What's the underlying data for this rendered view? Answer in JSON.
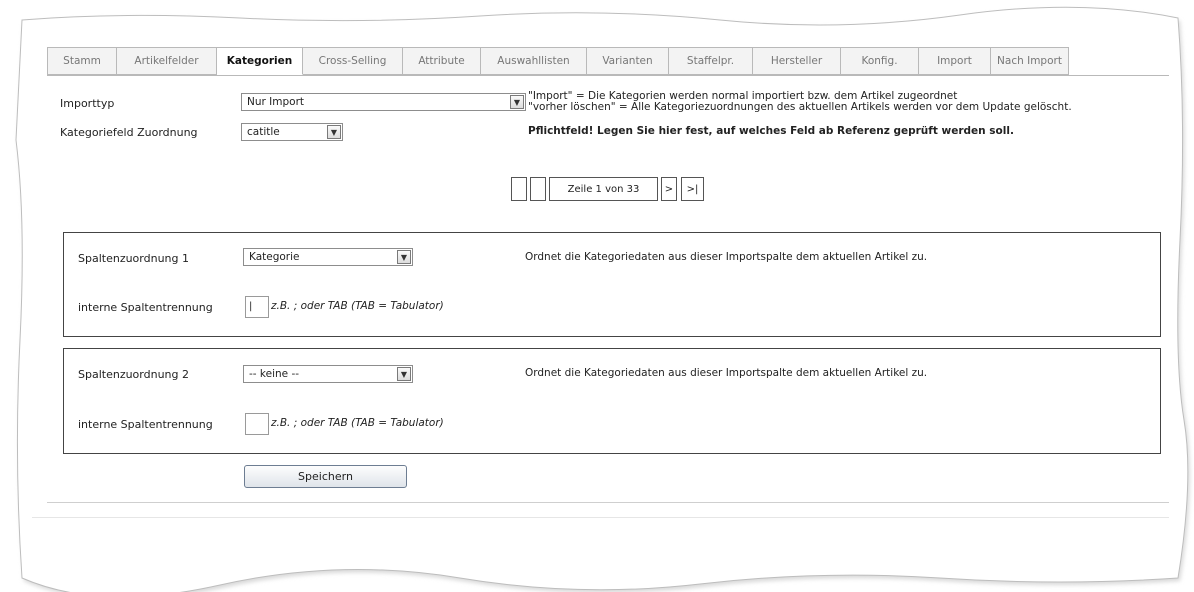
{
  "tabs": [
    "Stamm",
    "Artikelfelder",
    "Kategorien",
    "Cross-Selling",
    "Attribute",
    "Auswahllisten",
    "Varianten",
    "Staffelpr.",
    "Hersteller",
    "Konfig.",
    "Import",
    "Nach Import"
  ],
  "active_tab_index": 2,
  "importtyp": {
    "label": "Importtyp",
    "value": "Nur Import",
    "note_line1": "\"Import\" = Die Kategorien werden normal importiert bzw. dem Artikel zugeordnet",
    "note_line2": "\"vorher löschen\" = Alle Kategoriezuordnungen des aktuellen Artikels werden vor dem Update gelöscht."
  },
  "kategoriefeld": {
    "label": "Kategoriefeld Zuordnung",
    "value": "catitle",
    "note": "Pflichtfeld! Legen Sie hier fest, auf welches Feld ab Referenz geprüft werden soll."
  },
  "pager": {
    "text": "Zeile 1 von 33",
    "next": ">",
    "last": ">|"
  },
  "column1": {
    "label": "Spaltenzuordnung 1",
    "value": "Kategorie",
    "note": "Ordnet die Kategoriedaten aus dieser Importspalte dem aktuellen Artikel zu.",
    "sep_label": "interne Spaltentrennung",
    "sep_value": "|",
    "sep_hint": "z.B. ; oder TAB (TAB = Tabulator)"
  },
  "column2": {
    "label": "Spaltenzuordnung 2",
    "value": "-- keine --",
    "note": "Ordnet die Kategoriedaten aus dieser Importspalte dem aktuellen Artikel zu.",
    "sep_label": "interne Spaltentrennung",
    "sep_value": "",
    "sep_hint": "z.B. ; oder TAB (TAB = Tabulator)"
  },
  "save_label": "Speichern",
  "icons": {
    "dropdown": "chevron-down-icon"
  }
}
